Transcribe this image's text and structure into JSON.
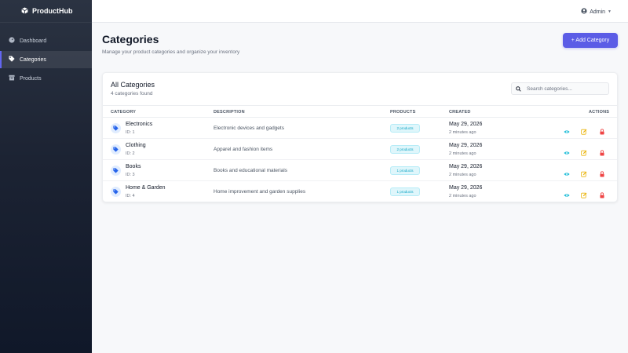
{
  "app": {
    "name": "ProductHub"
  },
  "sidebar": {
    "items": [
      {
        "label": "Dashboard",
        "icon": "dashboard-icon",
        "active": false
      },
      {
        "label": "Categories",
        "icon": "tag-icon",
        "active": true
      },
      {
        "label": "Products",
        "icon": "box-icon",
        "active": false
      }
    ]
  },
  "topbar": {
    "user_label": "Admin"
  },
  "page": {
    "title": "Categories",
    "subtitle": "Manage your product categories and organize your inventory",
    "add_button": "+ Add Category"
  },
  "card": {
    "title": "All Categories",
    "count": "4 categories found",
    "search_placeholder": "Search categories..."
  },
  "table": {
    "headers": [
      "CATEGORY",
      "DESCRIPTION",
      "PRODUCTS",
      "CREATED",
      "ACTIONS"
    ],
    "rows": [
      {
        "name": "Electronics",
        "id": "ID: 1",
        "description": "Electronic devices and gadgets",
        "products": "2 products",
        "created": "May 29, 2026",
        "ago": "2 minutes ago"
      },
      {
        "name": "Clothing",
        "id": "ID: 2",
        "description": "Apparel and fashion items",
        "products": "2 products",
        "created": "May 29, 2026",
        "ago": "2 minutes ago"
      },
      {
        "name": "Books",
        "id": "ID: 3",
        "description": "Books and educational materials",
        "products": "1 products",
        "created": "May 29, 2026",
        "ago": "2 minutes ago"
      },
      {
        "name": "Home & Garden",
        "id": "ID: 4",
        "description": "Home improvement and garden supplies",
        "products": "1 products",
        "created": "May 29, 2026",
        "ago": "2 minutes ago"
      }
    ]
  },
  "colors": {
    "accent": "#5b5ce6",
    "view": "#06b6d4",
    "edit": "#eab308",
    "delete": "#ef4444"
  }
}
